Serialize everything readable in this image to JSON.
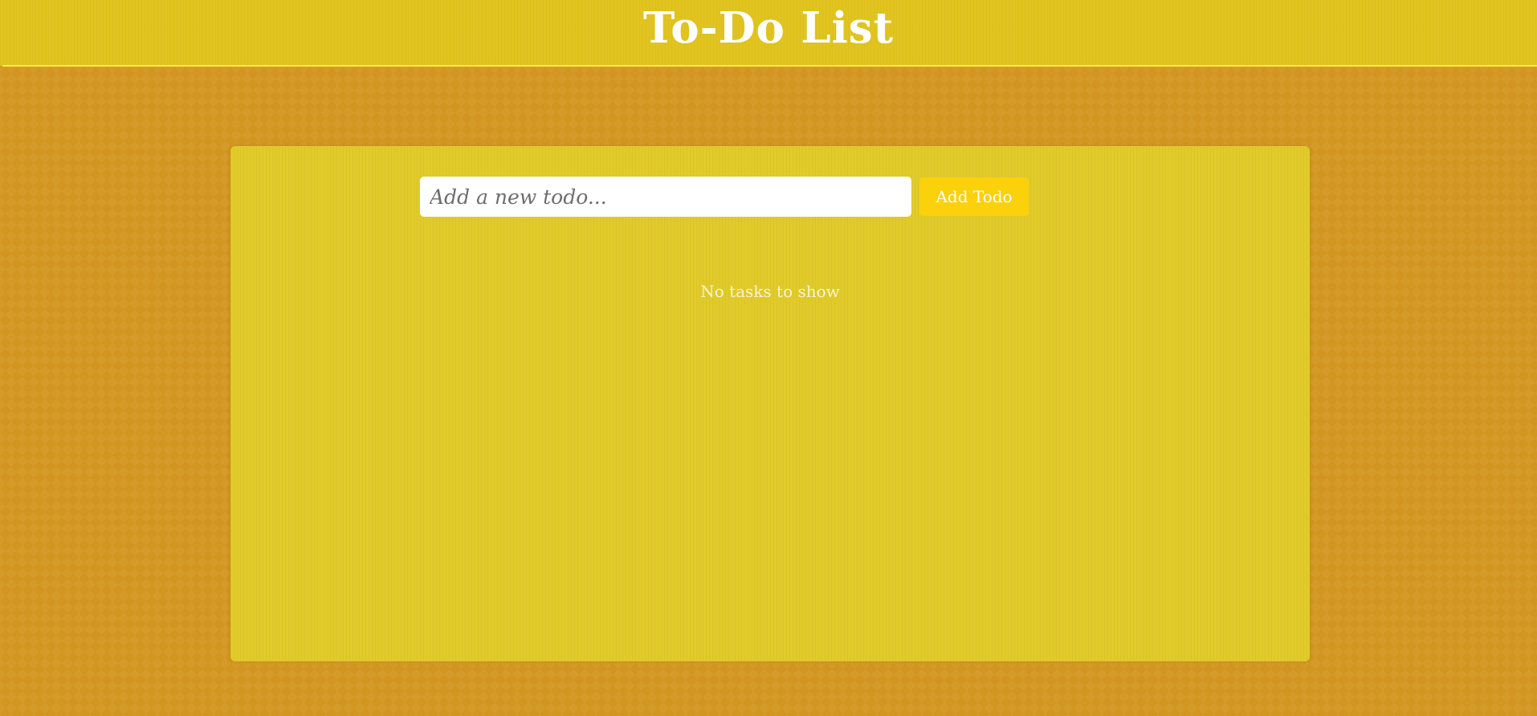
{
  "header": {
    "title": "To-Do List"
  },
  "todo_form": {
    "input_value": "",
    "input_placeholder": "Add a new todo...",
    "add_button_label": "Add Todo"
  },
  "task_list": {
    "empty_message": "No tasks to show",
    "items": []
  },
  "colors": {
    "page_background": "#d2951f",
    "header_background": "#e1c41f",
    "header_rule": "#f7ef3b",
    "panel_background": "#e1cb2a",
    "button_background": "#fbd10c",
    "text_light": "#ffffff"
  }
}
